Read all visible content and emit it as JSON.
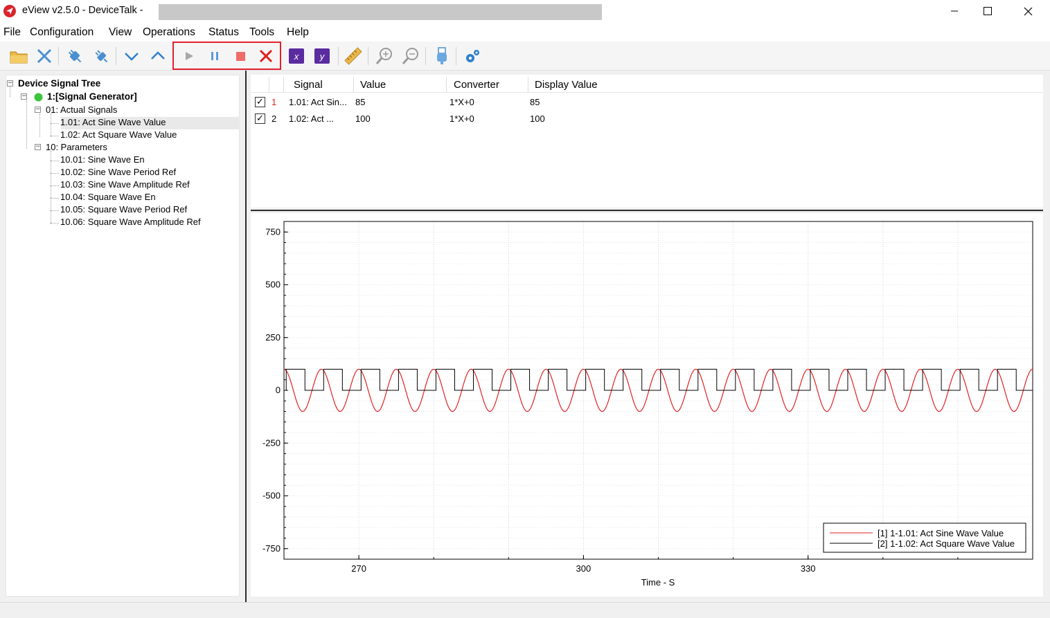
{
  "window": {
    "title": "eView v2.5.0 - DeviceTalk  -",
    "controls": [
      "minimize",
      "maximize",
      "close"
    ]
  },
  "menu": [
    "File",
    "Configuration",
    "View",
    "Operations",
    "Status",
    "Tools",
    "Help"
  ],
  "toolbar": {
    "buttons": [
      {
        "name": "open-folder-icon"
      },
      {
        "name": "disconnect-icon"
      },
      {
        "name": "plug-connect-icon"
      },
      {
        "name": "plug-disconnect-icon"
      },
      {
        "name": "chevron-down-icon"
      },
      {
        "name": "chevron-up-icon"
      },
      {
        "name": "play-icon"
      },
      {
        "name": "pause-icon"
      },
      {
        "name": "stop-icon"
      },
      {
        "name": "close-red-icon"
      },
      {
        "name": "x-axis-icon",
        "label": "x"
      },
      {
        "name": "y-axis-icon",
        "label": "y"
      },
      {
        "name": "ruler-icon"
      },
      {
        "name": "zoom-in-icon"
      },
      {
        "name": "zoom-out-icon"
      },
      {
        "name": "usb-icon"
      },
      {
        "name": "settings-gears-icon"
      }
    ]
  },
  "tree": {
    "root": "Device Signal Tree",
    "device": "1:[Signal Generator]",
    "groups": [
      {
        "label": "01: Actual Signals",
        "items": [
          "1.01: Act Sine Wave Value",
          "1.02: Act Square Wave Value"
        ]
      },
      {
        "label": "10: Parameters",
        "items": [
          "10.01: Sine Wave En",
          "10.02: Sine Wave Period Ref",
          "10.03: Sine Wave Amplitude Ref",
          "10.04: Square Wave En",
          "10.05: Square Wave Period Ref",
          "10.06: Square Wave Amplitude Ref"
        ]
      }
    ],
    "selected": "1.01: Act Sine Wave Value"
  },
  "table": {
    "headers": [
      "Signal",
      "Value",
      "Converter",
      "Display Value"
    ],
    "rows": [
      {
        "checked": true,
        "index": "1",
        "signal": "1.01: Act Sin...",
        "value": "85",
        "converter": "1*X+0",
        "display": "85",
        "color": "#e02020"
      },
      {
        "checked": true,
        "index": "2",
        "signal": "1.02: Act ...",
        "value": "100",
        "converter": "1*X+0",
        "display": "100",
        "color": "#000000"
      }
    ]
  },
  "chart_data": {
    "type": "line",
    "xlabel": "Time - S",
    "ylabel": "",
    "xlim": [
      260,
      360
    ],
    "ylim": [
      -800,
      800
    ],
    "xticks": [
      270,
      300,
      330
    ],
    "yticks": [
      750,
      500,
      250,
      0,
      -250,
      -500,
      -750
    ],
    "grid": true,
    "legend_position": "bottom-right",
    "series": [
      {
        "name": "[1] 1-1.01: Act Sine Wave Value",
        "color": "#e02020",
        "kind": "sine",
        "amplitude": 100,
        "period": 5,
        "cycles": 20
      },
      {
        "name": "[2] 1-1.02: Act Square Wave Value",
        "color": "#000000",
        "kind": "square",
        "high": 100,
        "low": 0,
        "period": 5
      }
    ]
  }
}
